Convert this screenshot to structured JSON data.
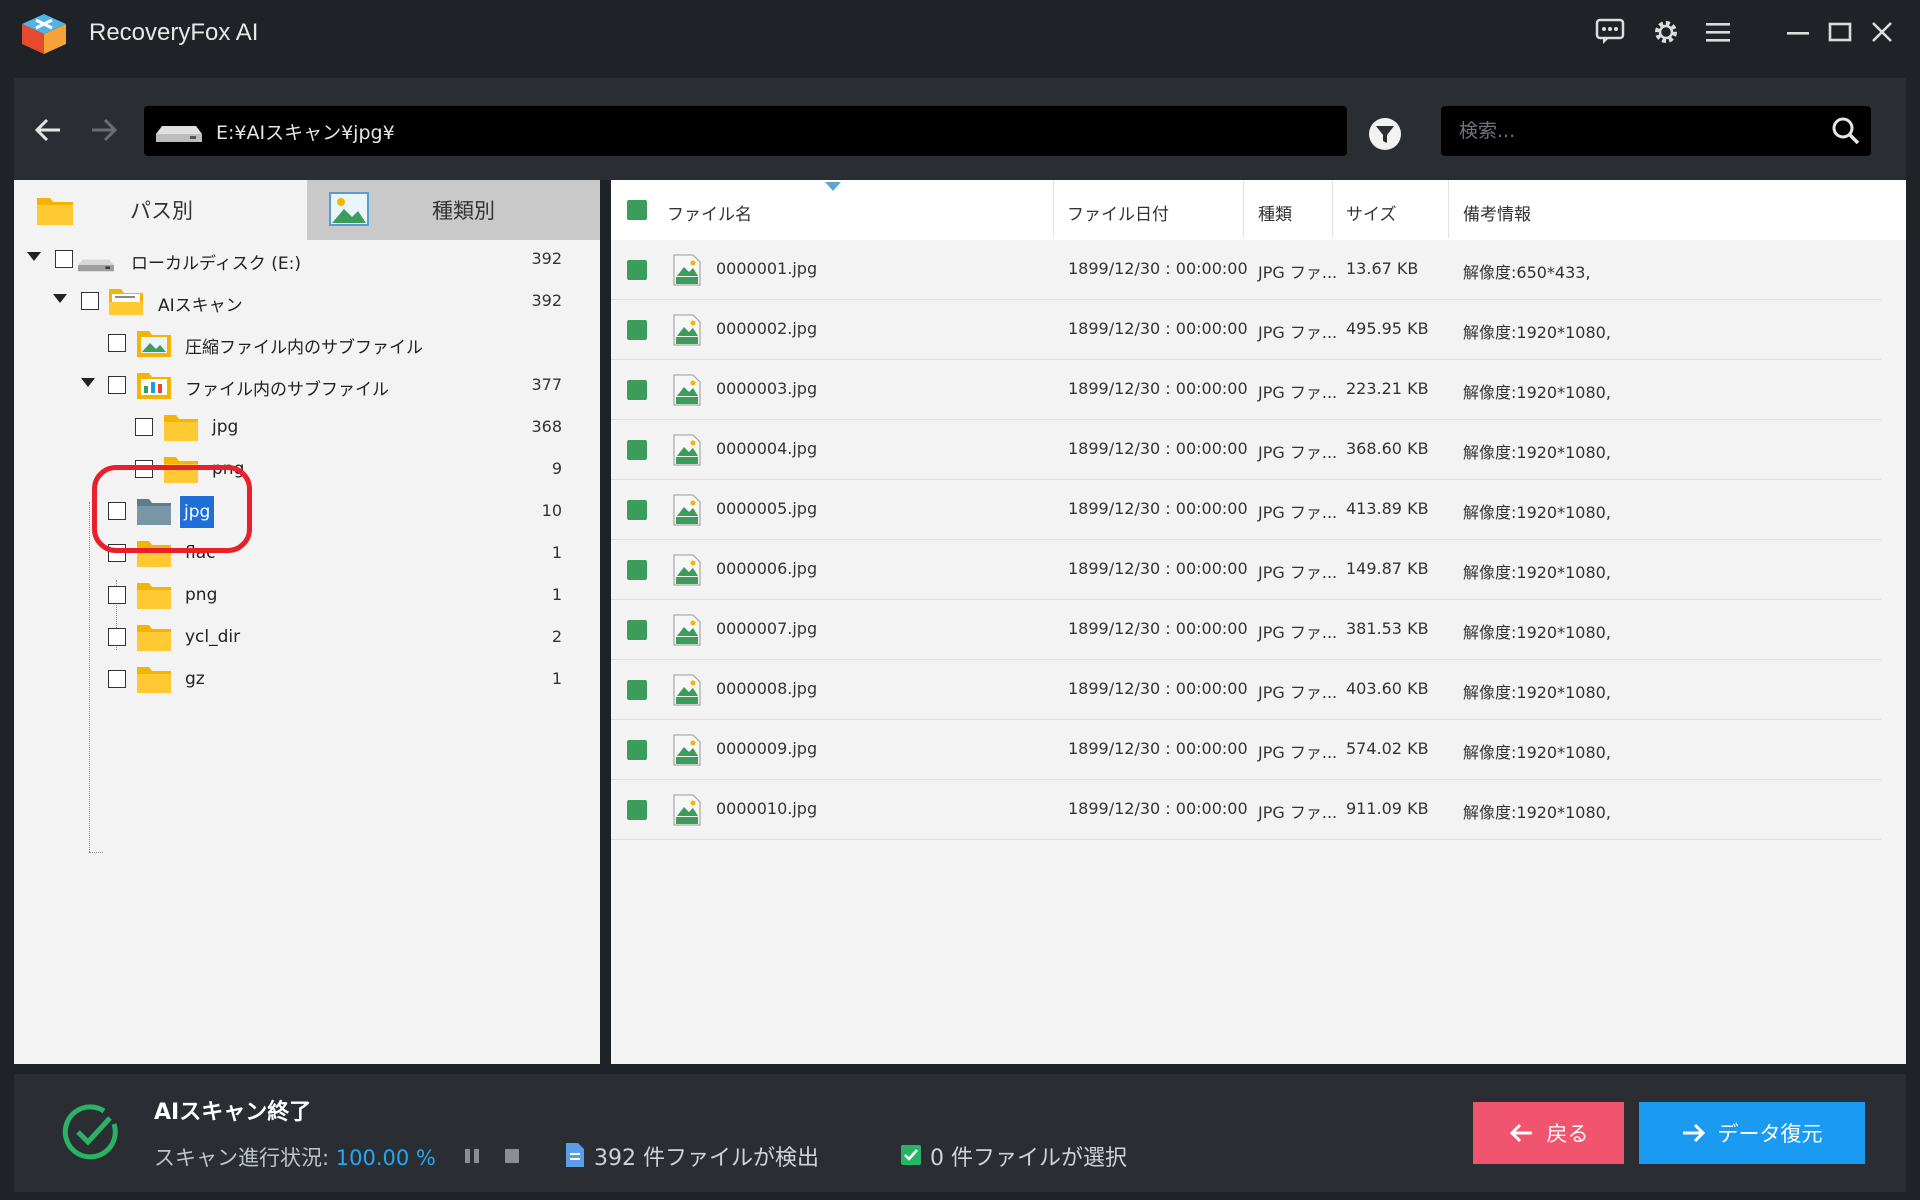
{
  "app": {
    "title": "RecoveryFox AI"
  },
  "nav": {
    "path": "E:¥AIスキャン¥jpg¥",
    "search_placeholder": "検索..."
  },
  "tabs": {
    "by_path": "パス別",
    "by_type": "種類別"
  },
  "tree": [
    {
      "label": "ローカルディスク (E:)",
      "count": "392"
    },
    {
      "label": "AIスキャン",
      "count": "392"
    },
    {
      "label": "圧縮ファイル内のサブファイル",
      "count": ""
    },
    {
      "label": "ファイル内のサブファイル",
      "count": "377"
    },
    {
      "label": "jpg",
      "count": "368"
    },
    {
      "label": "png",
      "count": "9"
    },
    {
      "label": "jpg",
      "count": "10"
    },
    {
      "label": "flac",
      "count": "1"
    },
    {
      "label": "png",
      "count": "1"
    },
    {
      "label": "ycl_dir",
      "count": "2"
    },
    {
      "label": "gz",
      "count": "1"
    }
  ],
  "table": {
    "headers": [
      "ファイル名",
      "ファイル日付",
      "種類",
      "サイズ",
      "備考情報"
    ],
    "rows": [
      {
        "name": "0000001.jpg",
        "date": "1899/12/30 : 00:00:00",
        "type": "JPG ファ...",
        "size": "13.67 KB",
        "info": "解像度:650*433,"
      },
      {
        "name": "0000002.jpg",
        "date": "1899/12/30 : 00:00:00",
        "type": "JPG ファ...",
        "size": "495.95 KB",
        "info": "解像度:1920*1080,"
      },
      {
        "name": "0000003.jpg",
        "date": "1899/12/30 : 00:00:00",
        "type": "JPG ファ...",
        "size": "223.21 KB",
        "info": "解像度:1920*1080,"
      },
      {
        "name": "0000004.jpg",
        "date": "1899/12/30 : 00:00:00",
        "type": "JPG ファ...",
        "size": "368.60 KB",
        "info": "解像度:1920*1080,"
      },
      {
        "name": "0000005.jpg",
        "date": "1899/12/30 : 00:00:00",
        "type": "JPG ファ...",
        "size": "413.89 KB",
        "info": "解像度:1920*1080,"
      },
      {
        "name": "0000006.jpg",
        "date": "1899/12/30 : 00:00:00",
        "type": "JPG ファ...",
        "size": "149.87 KB",
        "info": "解像度:1920*1080,"
      },
      {
        "name": "0000007.jpg",
        "date": "1899/12/30 : 00:00:00",
        "type": "JPG ファ...",
        "size": "381.53 KB",
        "info": "解像度:1920*1080,"
      },
      {
        "name": "0000008.jpg",
        "date": "1899/12/30 : 00:00:00",
        "type": "JPG ファ...",
        "size": "403.60 KB",
        "info": "解像度:1920*1080,"
      },
      {
        "name": "0000009.jpg",
        "date": "1899/12/30 : 00:00:00",
        "type": "JPG ファ...",
        "size": "574.02 KB",
        "info": "解像度:1920*1080,"
      },
      {
        "name": "0000010.jpg",
        "date": "1899/12/30 : 00:00:00",
        "type": "JPG ファ...",
        "size": "911.09 KB",
        "info": "解像度:1920*1080,"
      }
    ]
  },
  "status": {
    "title": "AIスキャン終了",
    "progress_label": "スキャン進行状況:",
    "progress_value": "100.00 %",
    "found": "392 件ファイルが検出",
    "selected": "0 件ファイルが選択"
  },
  "buttons": {
    "back": "戻る",
    "recover": "データ復元"
  },
  "colors": {
    "accent": "#1a9bf1",
    "back_button": "#f0546f",
    "check_green": "#3c9c5a",
    "highlight": "#e8202a"
  },
  "icons": [
    "logo",
    "feedback-icon",
    "settings-icon",
    "menu-icon",
    "minimize-icon",
    "maximize-icon",
    "close-icon",
    "back-arrow-icon",
    "forward-arrow-icon",
    "drive-icon",
    "filter-icon",
    "search-icon",
    "folder-icon",
    "image-folder-icon",
    "jpg-file-icon",
    "check-circle-icon",
    "pause-icon",
    "stop-icon",
    "document-icon",
    "checkbox-checked-icon"
  ]
}
